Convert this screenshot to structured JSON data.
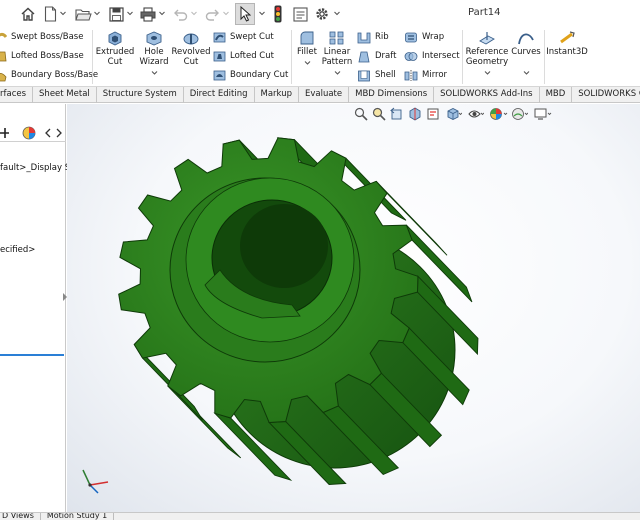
{
  "window": {
    "title": "Part14"
  },
  "ribbon": {
    "boss_swept": "Swept Boss/Base",
    "boss_lofted": "Lofted Boss/Base",
    "boss_boundary": "Boundary Boss/Base",
    "extruded_cut": [
      "Extruded",
      "Cut"
    ],
    "hole_wizard": [
      "Hole",
      "Wizard"
    ],
    "revolved_cut": [
      "Revolved",
      "Cut"
    ],
    "swept_cut": "Swept Cut",
    "lofted_cut": "Lofted Cut",
    "boundary_cut": "Boundary Cut",
    "fillet": "Fillet",
    "linear_pattern": [
      "Linear",
      "Pattern"
    ],
    "rib": "Rib",
    "draft": "Draft",
    "shell": "Shell",
    "wrap": "Wrap",
    "intersect": "Intersect",
    "mirror": "Mirror",
    "reference_geometry": [
      "Reference",
      "Geometry"
    ],
    "curves": "Curves",
    "instant3d": "Instant3D"
  },
  "tabs": [
    "rfaces",
    "Sheet Metal",
    "Structure System",
    "Direct Editing",
    "Markup",
    "Evaluate",
    "MBD Dimensions",
    "SOLIDWORKS Add-Ins",
    "MBD",
    "SOLIDWORKS CAM"
  ],
  "left_panel": {
    "tree_item_1": "fault>_Display S",
    "tree_item_2": "ecified>"
  },
  "bottom_tabs": [
    "D Views",
    "Motion Study 1"
  ],
  "colors": {
    "gear": "#2e7d1f",
    "gear_dark": "#1e5c12",
    "accent": "#2a7fd6",
    "triad_x": "#d32f2f",
    "triad_y": "#2e7d32",
    "triad_z": "#1565c0"
  },
  "icons": {
    "quick_access": [
      "home-icon",
      "new-document-icon",
      "open-folder-icon",
      "save-icon",
      "print-icon",
      "undo-icon",
      "redo-icon",
      "select-arrow-icon",
      "rebuild-traffic-light-icon",
      "file-properties-icon",
      "options-gear-icon"
    ],
    "view_toolbar": [
      "zoom-to-fit-icon",
      "zoom-area-icon",
      "previous-view-icon",
      "section-view-icon",
      "dynamic-annotation-icon",
      "view-orientation-icon",
      "display-style-icon",
      "hide-show-items-icon",
      "edit-appearance-icon",
      "apply-scene-icon",
      "view-settings-icon"
    ]
  }
}
